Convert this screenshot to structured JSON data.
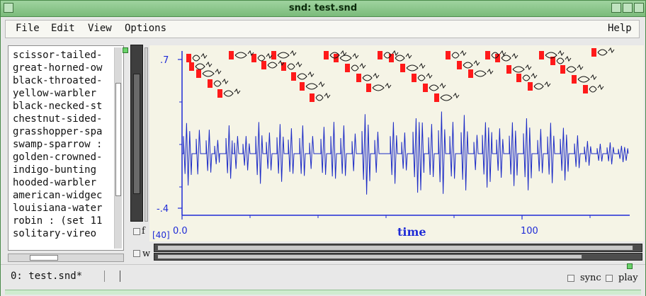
{
  "window": {
    "title": "snd: test.snd"
  },
  "menu": {
    "items": [
      "File",
      "Edit",
      "View",
      "Options"
    ],
    "help": "Help"
  },
  "sounds_list": {
    "items": [
      "scissor-tailed-",
      "great-horned-ow",
      "black-throated-",
      "yellow-warbler",
      "black-necked-st",
      "chestnut-sided-",
      "grasshopper-spa",
      "swamp-sparrow :",
      "golden-crowned-",
      "indigo-bunting",
      "hooded-warbler",
      "american-widgec",
      "louisiana-water",
      "robin : (set 11",
      "solitary-vireo"
    ]
  },
  "plot": {
    "y_max_label": ".7",
    "y_min_label": "-.4",
    "x_start_label": "0.0",
    "x_mid_label": "100",
    "xlabel": "time",
    "frame_label": "[40]",
    "f_label": "f",
    "w_label": "w",
    "color_axis": "#1f2bd6",
    "color_wave": "#1d2cc6",
    "color_marker": "#ff1a1a",
    "background": "#f5f4e6"
  },
  "status": {
    "sound_name": "0: test.snd*",
    "sync_label": "sync",
    "play_label": "play"
  },
  "colors": {
    "titlebar": "#7bbb7b",
    "panel": "#e8e8e8"
  }
}
